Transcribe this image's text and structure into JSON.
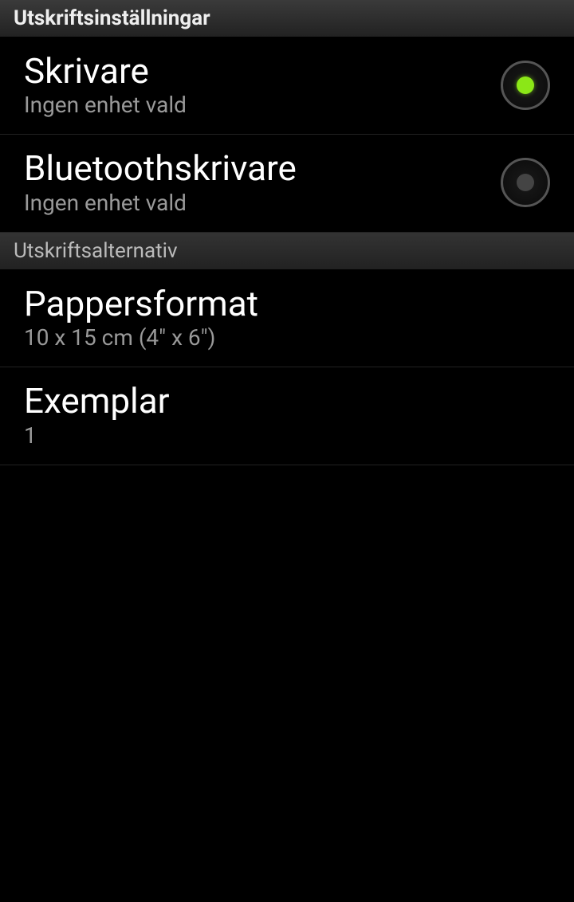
{
  "headers": {
    "main": "Utskriftsinställningar",
    "options": "Utskriftsalternativ"
  },
  "printer": {
    "title": "Skrivare",
    "subtitle": "Ingen enhet vald"
  },
  "bluetooth": {
    "title": "Bluetoothskrivare",
    "subtitle": "Ingen enhet vald"
  },
  "paper": {
    "title": "Pappersformat",
    "subtitle": "10 x 15 cm (4\" x 6\")"
  },
  "copies": {
    "title": "Exemplar",
    "subtitle": "1"
  }
}
